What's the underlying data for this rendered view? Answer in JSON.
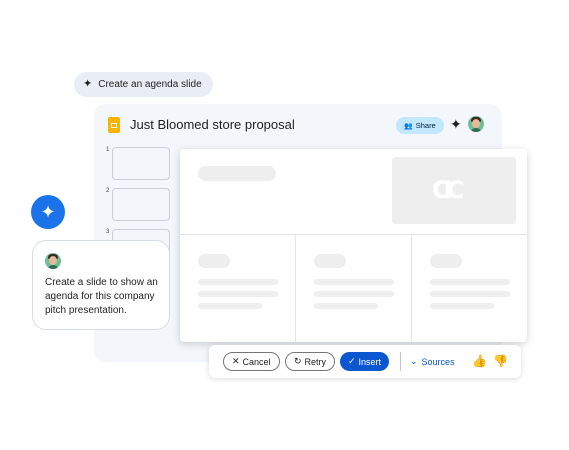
{
  "prompt_pill": {
    "label": "Create an agenda slide",
    "icon": "sparkle-icon"
  },
  "document": {
    "title": "Just Bloomed store proposal",
    "share_label": "Share",
    "thumbnails": [
      {
        "number": "1"
      },
      {
        "number": "2"
      },
      {
        "number": "3"
      }
    ]
  },
  "chat": {
    "message": "Create a slide to show an agenda for this company pitch presentation."
  },
  "actions": {
    "cancel": "Cancel",
    "retry": "Retry",
    "insert": "Insert",
    "sources": "Sources"
  },
  "colors": {
    "primary": "#0b57d0",
    "gemini_blue": "#1a73e8",
    "slides_yellow": "#f6b400"
  }
}
